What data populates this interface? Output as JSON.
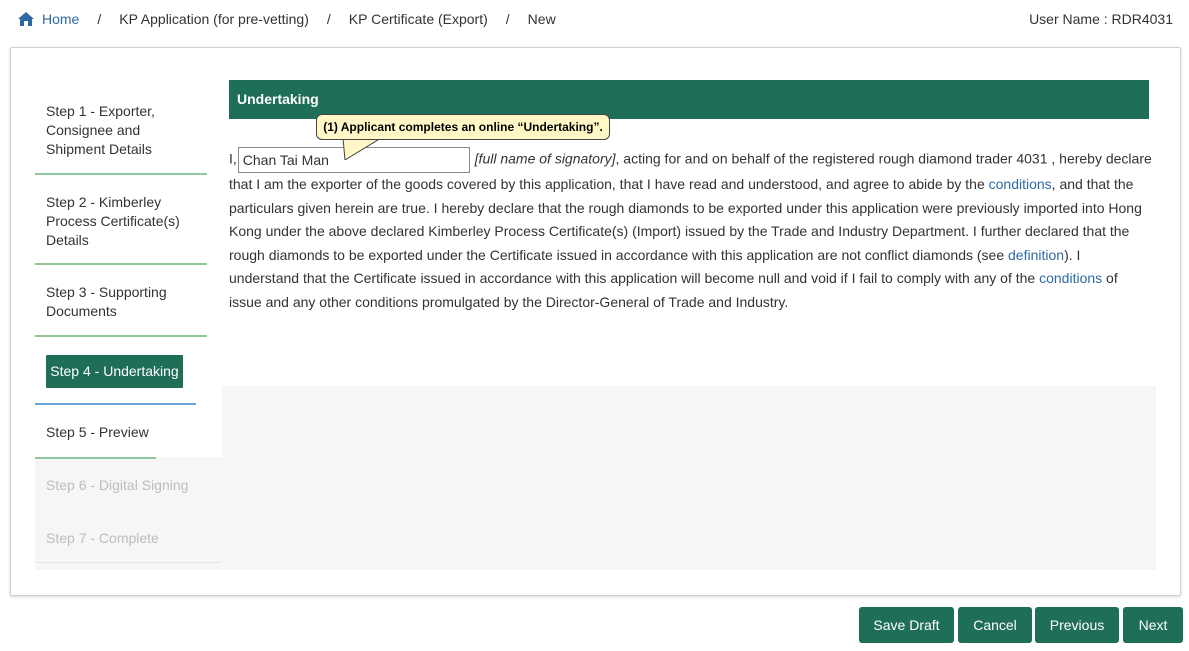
{
  "breadcrumb": {
    "home": "Home",
    "items": [
      "KP Application (for pre-vetting)",
      "KP Certificate (Export)",
      "New"
    ]
  },
  "user": "User Name : RDR4031",
  "steps": [
    "Step 1 - Exporter, Consignee and Shipment Details",
    "Step 2 - Kimberley Process Certificate(s) Details",
    "Step 3 - Supporting Documents",
    "Step 4 - Undertaking",
    "Step 5 - Preview",
    "Step 6 - Digital Signing",
    "Step 7 - Complete"
  ],
  "step_lines": {
    "s1": [
      "Step 1 - Exporter,",
      "Consignee and",
      "Shipment Details"
    ],
    "s2": [
      "Step 2 - Kimberley",
      "Process Certificate(s)",
      "Details"
    ],
    "s3": [
      "Step 3 - Supporting",
      "Documents"
    ]
  },
  "panel": {
    "title": "Undertaking",
    "callout": "(1) Applicant  completes an online “Undertaking”.",
    "prefix": "I,",
    "name_value": "Chan Tai Man",
    "hint": "[full name of signatory]",
    "text1": ", acting for and on behalf of the registered rough diamond trader 4031 , hereby declare that I am the exporter of the goods covered by this application, that I have read and understood, and agree to abide by the ",
    "link_conditions": "conditions",
    "text2": ", and that the particulars given herein are true. I hereby declare that the rough diamonds to be exported under this application were previously imported into Hong Kong under the above declared Kimberley Process Certificate(s) (Import) issued by the Trade and Industry Department. I further declared that the rough diamonds to be exported under the Certificate issued in accordance with this application are not conflict diamonds (see ",
    "link_definition": "definition",
    "text3": "). I understand that the Certificate issued in accordance with this application will become null and void if I fail to comply with any of the ",
    "text4": " of issue and any other conditions promulgated by the Director-General of Trade and Industry."
  },
  "buttons": {
    "save_draft": "Save Draft",
    "cancel": "Cancel",
    "previous": "Previous",
    "next": "Next"
  },
  "colors": {
    "primary": "#1e6e58",
    "link": "#2d6aa3",
    "callout_bg": "#fff8c6"
  }
}
